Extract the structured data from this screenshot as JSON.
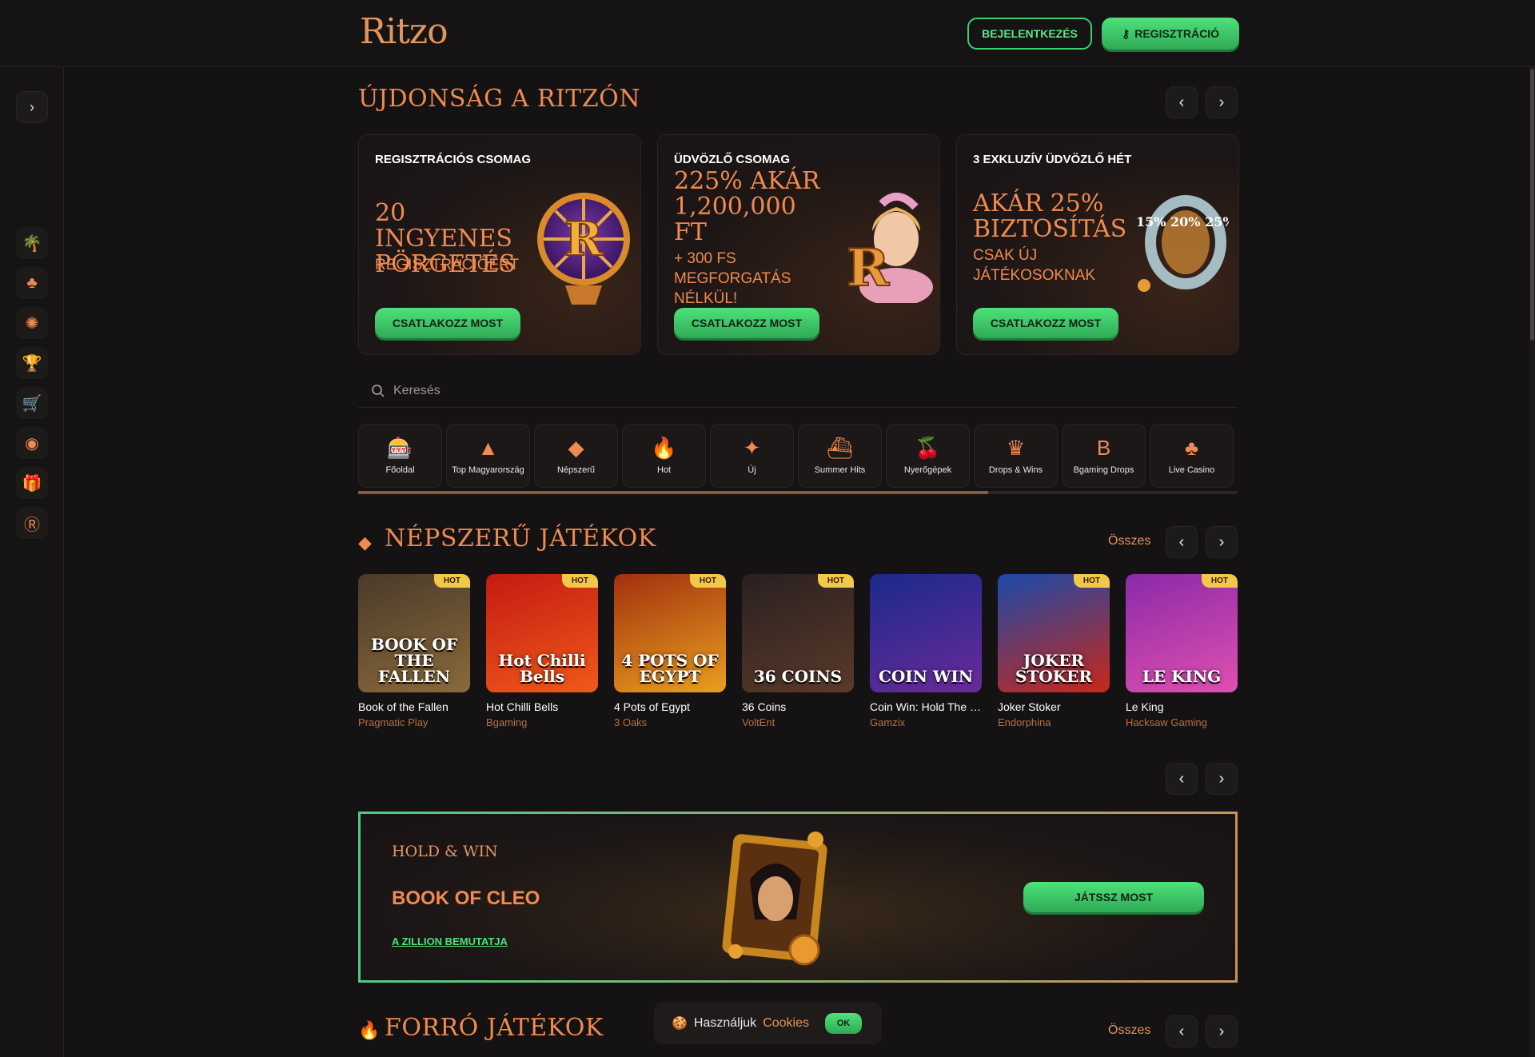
{
  "header": {
    "logo": "Ritzo",
    "login_label": "BEJELENTKEZÉS",
    "register_label": "REGISZTRÁCIÓ"
  },
  "sidebar": {
    "items": [
      {
        "icon": "palm-icon",
        "glyph": "🌴"
      },
      {
        "icon": "club-icon",
        "glyph": "♣"
      },
      {
        "icon": "percent-badge-icon",
        "glyph": "✺"
      },
      {
        "icon": "trophy-icon",
        "glyph": "🏆"
      },
      {
        "icon": "cart-icon",
        "glyph": "🛒"
      },
      {
        "icon": "chip-icon",
        "glyph": "◉"
      },
      {
        "icon": "gift-icon",
        "glyph": "🎁"
      },
      {
        "icon": "ritzo-r-icon",
        "glyph": "Ⓡ"
      }
    ]
  },
  "news": {
    "title": "ÚJDONSÁG A RITZÓN",
    "cards": [
      {
        "label": "REGISZTRÁCIÓS CSOMAG",
        "big": "20 INGYENES PÖRGETÉS",
        "sub": "REGISZTRÁCIÓÉRT",
        "button": "CSATLAKOZZ MOST"
      },
      {
        "label": "ÜDVÖZLŐ CSOMAG",
        "big": "225% AKÁR 1,200,000 FT",
        "sub": "+ 300 FS MEGFORGATÁS NÉLKÜL!",
        "button": "CSATLAKOZZ MOST"
      },
      {
        "label": "3 EXKLUZÍV ÜDVÖZLŐ HÉT",
        "big": "AKÁR 25% BIZTOSÍTÁS",
        "sub": "CSAK ÚJ JÁTÉKOSOKNAK",
        "button": "CSATLAKOZZ MOST",
        "art_text": "15% 20% 25%"
      }
    ]
  },
  "search": {
    "placeholder": "Keresés"
  },
  "categories": [
    {
      "label": "Főoldal",
      "icon": "slot-machine-icon"
    },
    {
      "label": "Top Magyarország",
      "icon": "star-triangle-icon"
    },
    {
      "label": "Népszerű",
      "icon": "diamond-icon"
    },
    {
      "label": "Hot",
      "icon": "flame-icon"
    },
    {
      "label": "Új",
      "icon": "sparkle-icon"
    },
    {
      "label": "Summer Hits",
      "icon": "ship-icon"
    },
    {
      "label": "Nyerőgépek",
      "icon": "cherry-icon"
    },
    {
      "label": "Drops & Wins",
      "icon": "crown-icon"
    },
    {
      "label": "Bgaming Drops",
      "icon": "b-letter-icon"
    },
    {
      "label": "Live Casino",
      "icon": "club-icon"
    }
  ],
  "popular": {
    "title": "NÉPSZERŰ JÁTÉKOK",
    "all_label": "Összes",
    "games": [
      {
        "name": "Book of the Fallen",
        "provider": "Pragmatic Play",
        "badge": "HOT",
        "art": "BOOK OF THE FALLEN",
        "color1": "#4a3a2a",
        "color2": "#8a6a3a"
      },
      {
        "name": "Hot Chilli Bells",
        "provider": "Bgaming",
        "badge": "HOT",
        "art": "Hot Chilli Bells",
        "color1": "#c41a12",
        "color2": "#f05a1a"
      },
      {
        "name": "4 Pots of Egypt",
        "provider": "3 Oaks",
        "badge": "HOT",
        "art": "4 POTS OF EGYPT",
        "color1": "#a3300e",
        "color2": "#e8a020"
      },
      {
        "name": "36 Coins",
        "provider": "VoltEnt",
        "badge": "HOT",
        "art": "36 COINS",
        "color1": "#2a2020",
        "color2": "#5a3a2a"
      },
      {
        "name": "Coin Win: Hold The Spin",
        "provider": "Gamzix",
        "badge": "",
        "art": "COIN WIN",
        "color1": "#1a2a8a",
        "color2": "#6a2a9a"
      },
      {
        "name": "Joker Stoker",
        "provider": "Endorphina",
        "badge": "HOT",
        "art": "JOKER STOKER",
        "color1": "#1a4aaa",
        "color2": "#c8281a"
      },
      {
        "name": "Le King",
        "provider": "Hacksaw Gaming",
        "badge": "HOT",
        "art": "LE KING",
        "color1": "#8a2aa8",
        "color2": "#e050b0"
      }
    ]
  },
  "featured": {
    "tag": "HOLD & WIN",
    "title": "BOOK OF CLEO",
    "link": "A ZILLION BEMUTATJA",
    "button": "JÁTSSZ MOST"
  },
  "hot": {
    "title": "FORRÓ JÁTÉKOK",
    "all_label": "Összes"
  },
  "cookie": {
    "text": "Használjuk",
    "link": "Cookies",
    "ok": "OK"
  },
  "colors": {
    "accent": "#ef8a52",
    "green": "#4ee27b",
    "background": "#141212"
  }
}
